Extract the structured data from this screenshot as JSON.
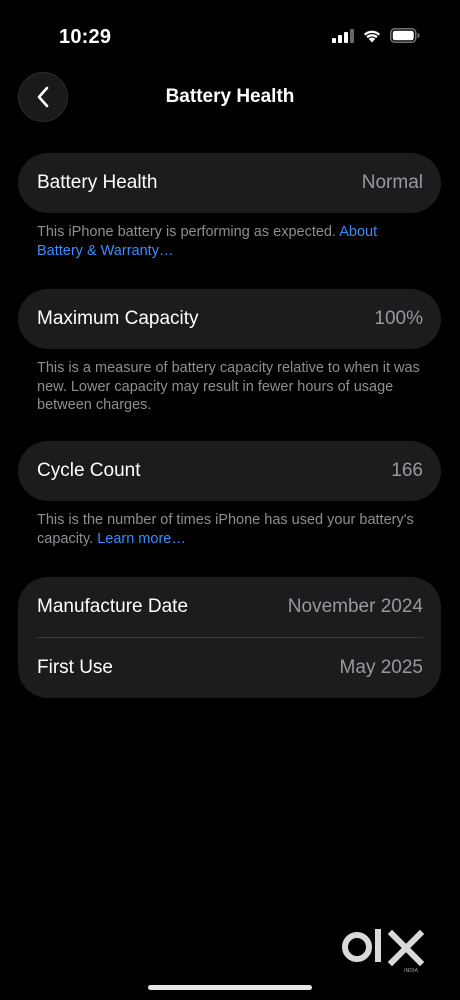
{
  "status_bar": {
    "time": "10:29"
  },
  "nav": {
    "title": "Battery Health",
    "back_icon": "chevron-left-icon"
  },
  "battery_health": {
    "label": "Battery Health",
    "value": "Normal",
    "footnote_text": "This iPhone battery is performing as expected. ",
    "footnote_link": "About Battery & Warranty…"
  },
  "maximum_capacity": {
    "label": "Maximum Capacity",
    "value": "100%",
    "footnote_text": "This is a measure of battery capacity relative to when it was new. Lower capacity may result in fewer hours of usage between charges."
  },
  "cycle_count": {
    "label": "Cycle Count",
    "value": "166",
    "footnote_text": "This is the number of times iPhone has used your battery's capacity. ",
    "footnote_link": "Learn more…"
  },
  "dates": {
    "manufacture_label": "Manufacture Date",
    "manufacture_value": "November 2024",
    "first_use_label": "First Use",
    "first_use_value": "May 2025"
  },
  "watermark": {
    "text": "OLX",
    "subtext": "INDIA"
  },
  "colors": {
    "background": "#000000",
    "card": "#1c1c1e",
    "link": "#3a8dff",
    "secondary_text": "#98989e"
  }
}
